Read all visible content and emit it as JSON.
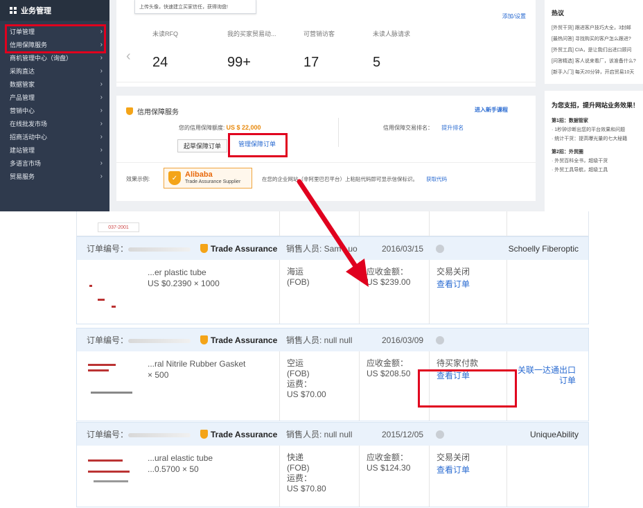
{
  "sidebar": {
    "title": "业务管理",
    "items": [
      {
        "label": "订单管理"
      },
      {
        "label": "信用保障服务"
      },
      {
        "label": "商机管理中心（询盘）"
      },
      {
        "label": "采购直达"
      },
      {
        "label": "数据管家"
      },
      {
        "label": "产品管理"
      },
      {
        "label": "营销中心"
      },
      {
        "label": "在线批发市场"
      },
      {
        "label": "招商活动中心"
      },
      {
        "label": "建站管理"
      },
      {
        "label": "多语言市场"
      },
      {
        "label": "贸易服务"
      }
    ]
  },
  "dashboard": {
    "tooltip": "上传头像，快速建立买家信任，获得询盘!",
    "add_settings": "添加/设置",
    "stats": [
      {
        "label": "未读RFQ",
        "value": "24"
      },
      {
        "label": "我的买家贸易动...",
        "value": "99+"
      },
      {
        "label": "可营销访客",
        "value": "17"
      },
      {
        "label": "未读人脉请求",
        "value": "5"
      }
    ]
  },
  "trade_assurance": {
    "title": "信用保障服务",
    "guide_link": "进入新手课程",
    "limit_label": "您的信用保障额度:",
    "limit_value": "US $ 22,000",
    "rank_label": "信用保障交易排名：",
    "rank_link": "提升排名",
    "start_button": "起草保障订单",
    "manage_link": "管理保障订单",
    "effect_label": "效果示例:",
    "badge_brand": "Alibaba",
    "badge_sub": "Trade Assurance Supplier",
    "embed_text": "在您的企业网站（非阿里巴巴平台）上粘贴代码即可显示信保标识。",
    "code_link": "获取代码"
  },
  "right_panel": {
    "hot_title": "热议",
    "news": [
      "[外贸干货] 跟进客户技巧大全，3封邮",
      "[最热问答] 寻找购买的客户怎么跟进?",
      "[外贸工具] CIA，是让我们出进口顾问",
      "[问答精选] 客人说来看厂，该准备什么?",
      "[新手入门] 每天20分钟，开启贸易10天"
    ],
    "promo_title": "为您支招，提升网站业务效果！",
    "tips": [
      {
        "head": "第1招：数据管家",
        "lines": [
          "· 1秒钟诊断出您的平台效果和问题",
          "· 统计干货：提高曝光量的七大秘籍"
        ]
      },
      {
        "head": "第2招：外贸圈",
        "lines": [
          "· 外贸百科全书，超级干货",
          "· 外贸工具导航，超级工具"
        ]
      }
    ]
  },
  "orders": {
    "fragment_stamp": "037-2001",
    "order_no_label": "订单编号：",
    "ta_label": "Trade Assurance",
    "list": [
      {
        "sales": "销售人员: Sam Luo",
        "date": "2016/03/15",
        "buyer": "Schoelly Fiberoptic",
        "product": "...er plastic tube",
        "price_qty": "US $0.2390 × 1000",
        "ship_method": "海运",
        "ship_term": "(FOB)",
        "freight_label": "",
        "freight_value": "",
        "amount_label": "应收金额：",
        "amount_value": "US $239.00",
        "status": "交易关闭",
        "view": "查看订单",
        "extra": ""
      },
      {
        "sales": "销售人员: null null",
        "date": "2016/03/09",
        "buyer": "",
        "product": "...ral Nitrile Rubber Gasket",
        "price_qty": "× 500",
        "ship_method": "空运",
        "ship_term": "(FOB)",
        "freight_label": "运费：",
        "freight_value": "US $70.00",
        "amount_label": "应收金额：",
        "amount_value": "US $208.50",
        "status": "待买家付款",
        "view": "查看订单",
        "extra": "关联一达通出口订单"
      },
      {
        "sales": "销售人员: null null",
        "date": "2015/12/05",
        "buyer": "UniqueAbility",
        "product": "...ural elastic tube",
        "price_qty": "...0.5700 × 50",
        "ship_method": "快递",
        "ship_term": "(FOB)",
        "freight_label": "运费：",
        "freight_value": "US $70.80",
        "amount_label": "应收金额：",
        "amount_value": "US $124.30",
        "status": "交易关闭",
        "view": "查看订单",
        "extra": ""
      }
    ]
  },
  "colors": {
    "sidebar_bg": "#2f3a4d",
    "highlight_red": "#e0001e",
    "link_blue": "#2a6bd1",
    "ta_orange": "#f4a418",
    "order_header_bg": "#eaf2fb"
  }
}
